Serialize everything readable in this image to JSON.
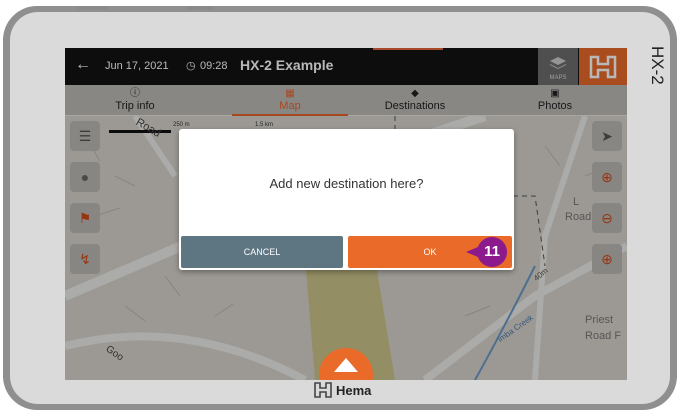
{
  "device": {
    "side_label": "HX-2",
    "brand": "Hema"
  },
  "topbar": {
    "back_icon": "arrow-left-icon",
    "date": "Jun 17, 2021",
    "clock_icon": "clock-icon",
    "time": "09:28",
    "title": "HX-2 Example",
    "maps_label": "MAPS",
    "accent": "#ea6b2c"
  },
  "tabs": [
    {
      "label": "Trip info",
      "icon": "info-icon"
    },
    {
      "label": "Map",
      "icon": "map-icon",
      "active": true
    },
    {
      "label": "Destinations",
      "icon": "directions-icon"
    },
    {
      "label": "Photos",
      "icon": "camera-icon"
    }
  ],
  "map": {
    "scale_labels": [
      "250 m",
      "1.5 km"
    ],
    "road_labels": [
      "Road",
      "Road",
      "Priest",
      "Road F",
      "40m",
      "imba Creek",
      "Goo",
      "L"
    ]
  },
  "dialog": {
    "message": "Add new destination here?",
    "cancel_label": "CANCEL",
    "ok_label": "OK"
  },
  "callout": {
    "number": "11",
    "color": "#8c1a8c"
  }
}
